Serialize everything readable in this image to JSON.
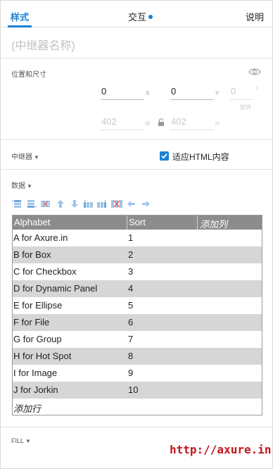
{
  "tabs": [
    {
      "label": "样式",
      "active": true
    },
    {
      "label": "交互",
      "has_dot": true
    },
    {
      "label": "说明"
    }
  ],
  "name_placeholder": "(中继器名称)",
  "position": {
    "section_label": "位置和尺寸",
    "x_value": "0",
    "x_unit": "X",
    "y_value": "0",
    "y_unit": "Y",
    "rotation_value": "0",
    "rotation_unit": "°",
    "rotation_label": "旋转",
    "w_value": "402",
    "w_unit": "W",
    "h_value": "402",
    "h_unit": "H"
  },
  "repeater": {
    "section_label": "中继器",
    "fit_html_label": "适应HTML内容",
    "fit_html_checked": true
  },
  "data_section": {
    "section_label": "数据",
    "toolbar_icons": [
      "insert-row-above-icon",
      "insert-row-below-icon",
      "delete-row-icon",
      "move-row-up-icon",
      "move-row-down-icon",
      "insert-column-left-icon",
      "insert-column-right-icon",
      "delete-column-icon",
      "move-column-left-icon",
      "move-column-right-icon"
    ],
    "columns": [
      "Alphabet",
      "Sort",
      "添加列"
    ],
    "rows": [
      [
        "A for Axure.in",
        "1"
      ],
      [
        "B for Box",
        "2"
      ],
      [
        "C for Checkbox",
        "3"
      ],
      [
        "D for Dynamic Panel",
        "4"
      ],
      [
        "E for Ellipse",
        "5"
      ],
      [
        "F for File",
        "6"
      ],
      [
        "G for Group",
        "7"
      ],
      [
        "H for Hot Spot",
        "8"
      ],
      [
        "I for Image",
        "9"
      ],
      [
        "J for Jorkin",
        "10"
      ]
    ],
    "add_row_label": "添加行"
  },
  "fill": {
    "section_label": "FILL"
  },
  "watermark": "http://axure.in",
  "colors": {
    "accent": "#1a82d6",
    "header_bg": "#8c8c8c",
    "alt_row": "#d6d6d6",
    "watermark": "#c4161c"
  }
}
